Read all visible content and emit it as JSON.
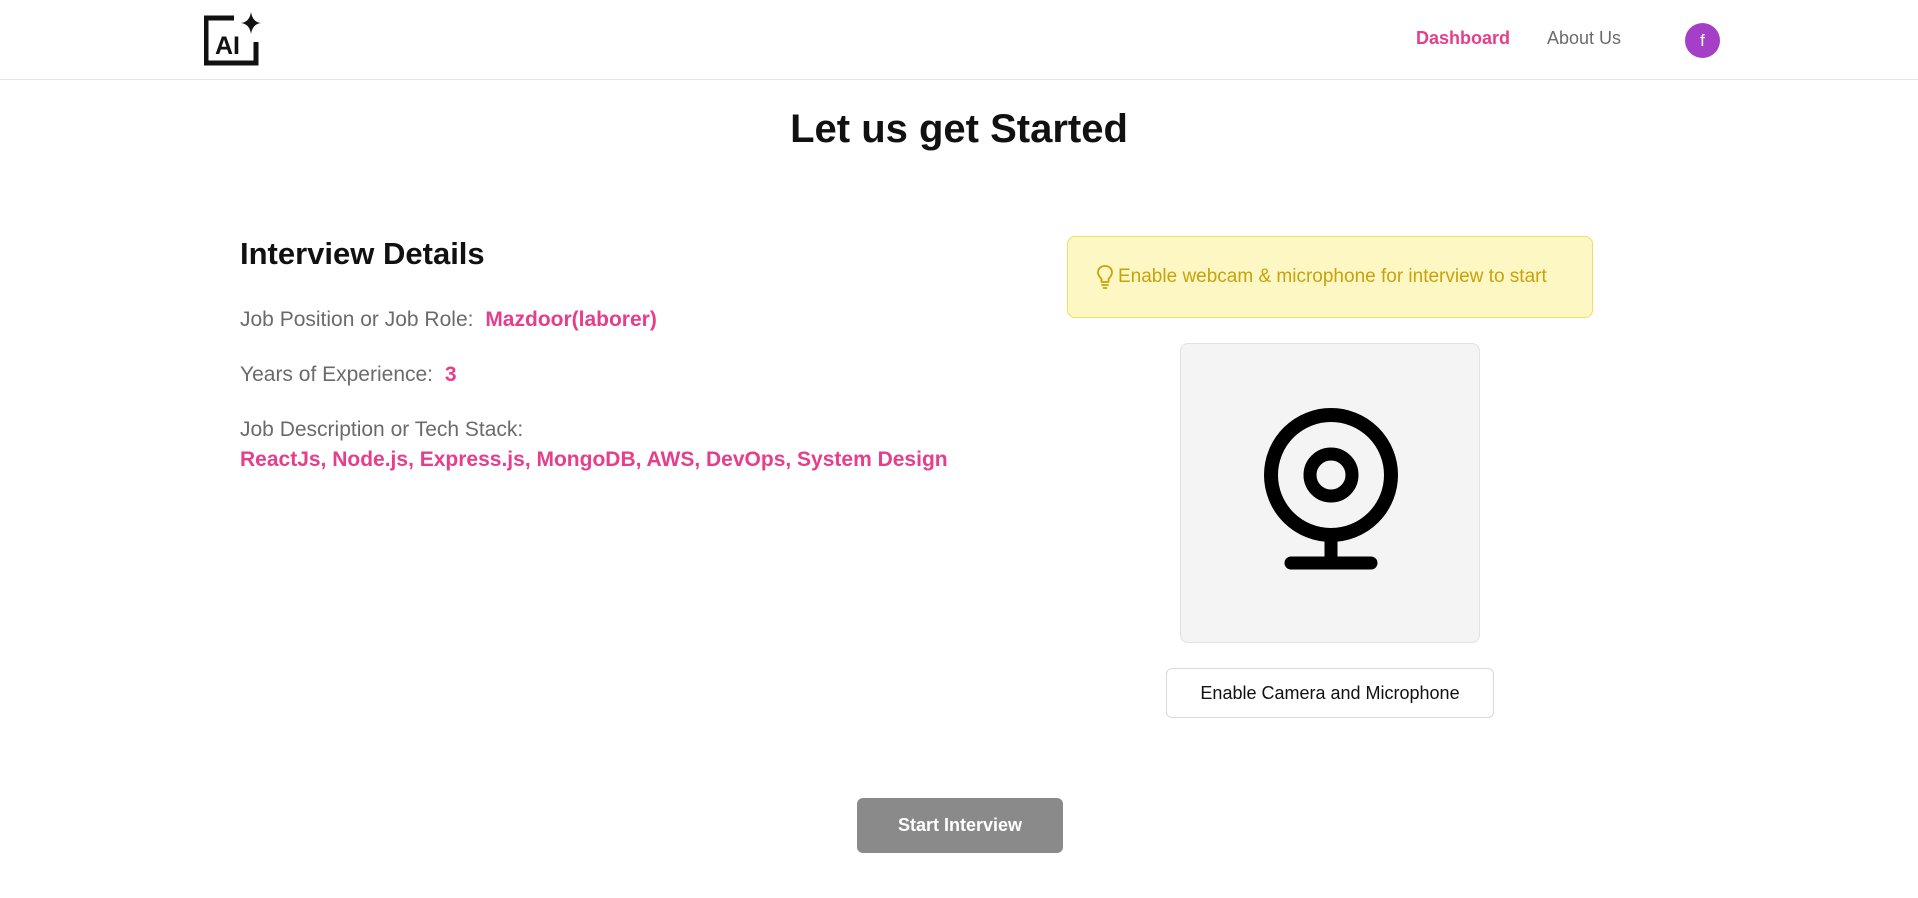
{
  "header": {
    "logo_icon": "ai-sparkle-logo-icon",
    "logo_text": "AI",
    "nav": {
      "dashboard": "Dashboard",
      "about": "About Us"
    },
    "avatar_initial": "f"
  },
  "page_title": "Let us get Started",
  "details": {
    "heading": "Interview Details",
    "role_label": "Job Position or Job Role:",
    "role_value": "Mazdoor(laborer)",
    "experience_label": "Years of Experience:",
    "experience_value": "3",
    "description_label": "Job Description or Tech Stack:",
    "description_value": "ReactJs, Node.js, Express.js, MongoDB, AWS, DevOps, System Design"
  },
  "notice": {
    "icon": "lightbulb-icon",
    "text": "Enable webcam & microphone for interview to start"
  },
  "webcam": {
    "icon": "webcam-icon"
  },
  "buttons": {
    "enable_camera": "Enable Camera and Microphone",
    "start_interview": "Start Interview"
  },
  "colors": {
    "accent": "#e63e8c",
    "avatar": "#a63fc7",
    "notice_bg": "#fdf7c3",
    "notice_text": "#c9a20b",
    "start_button": "#8a8a8a"
  }
}
